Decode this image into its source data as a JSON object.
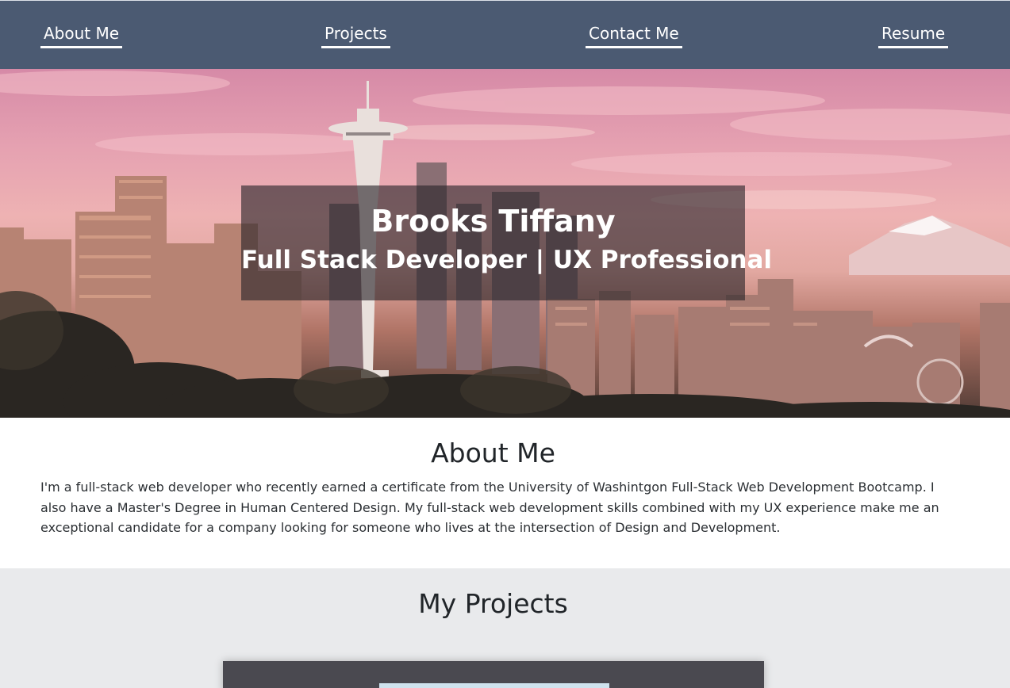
{
  "nav": {
    "items": [
      {
        "label": "About Me"
      },
      {
        "label": "Projects"
      },
      {
        "label": "Contact Me"
      },
      {
        "label": "Resume"
      }
    ],
    "bg_color": "#4b5a72"
  },
  "hero": {
    "name": "Brooks Tiffany",
    "title": "Full Stack Developer | UX Professional",
    "background": "seattle-skyline-photo"
  },
  "about": {
    "heading": "About Me",
    "text": "I'm a full-stack web developer who recently earned a certificate from the University of Washintgon Full-Stack Web Development Bootcamp. I also have a Master's Degree in Human Centered Design. My full-stack web development skills combined with my UX experience make me an exceptional candidate for a company looking for someone who lives at the intersection of Design and Development."
  },
  "projects": {
    "heading": "My Projects"
  }
}
